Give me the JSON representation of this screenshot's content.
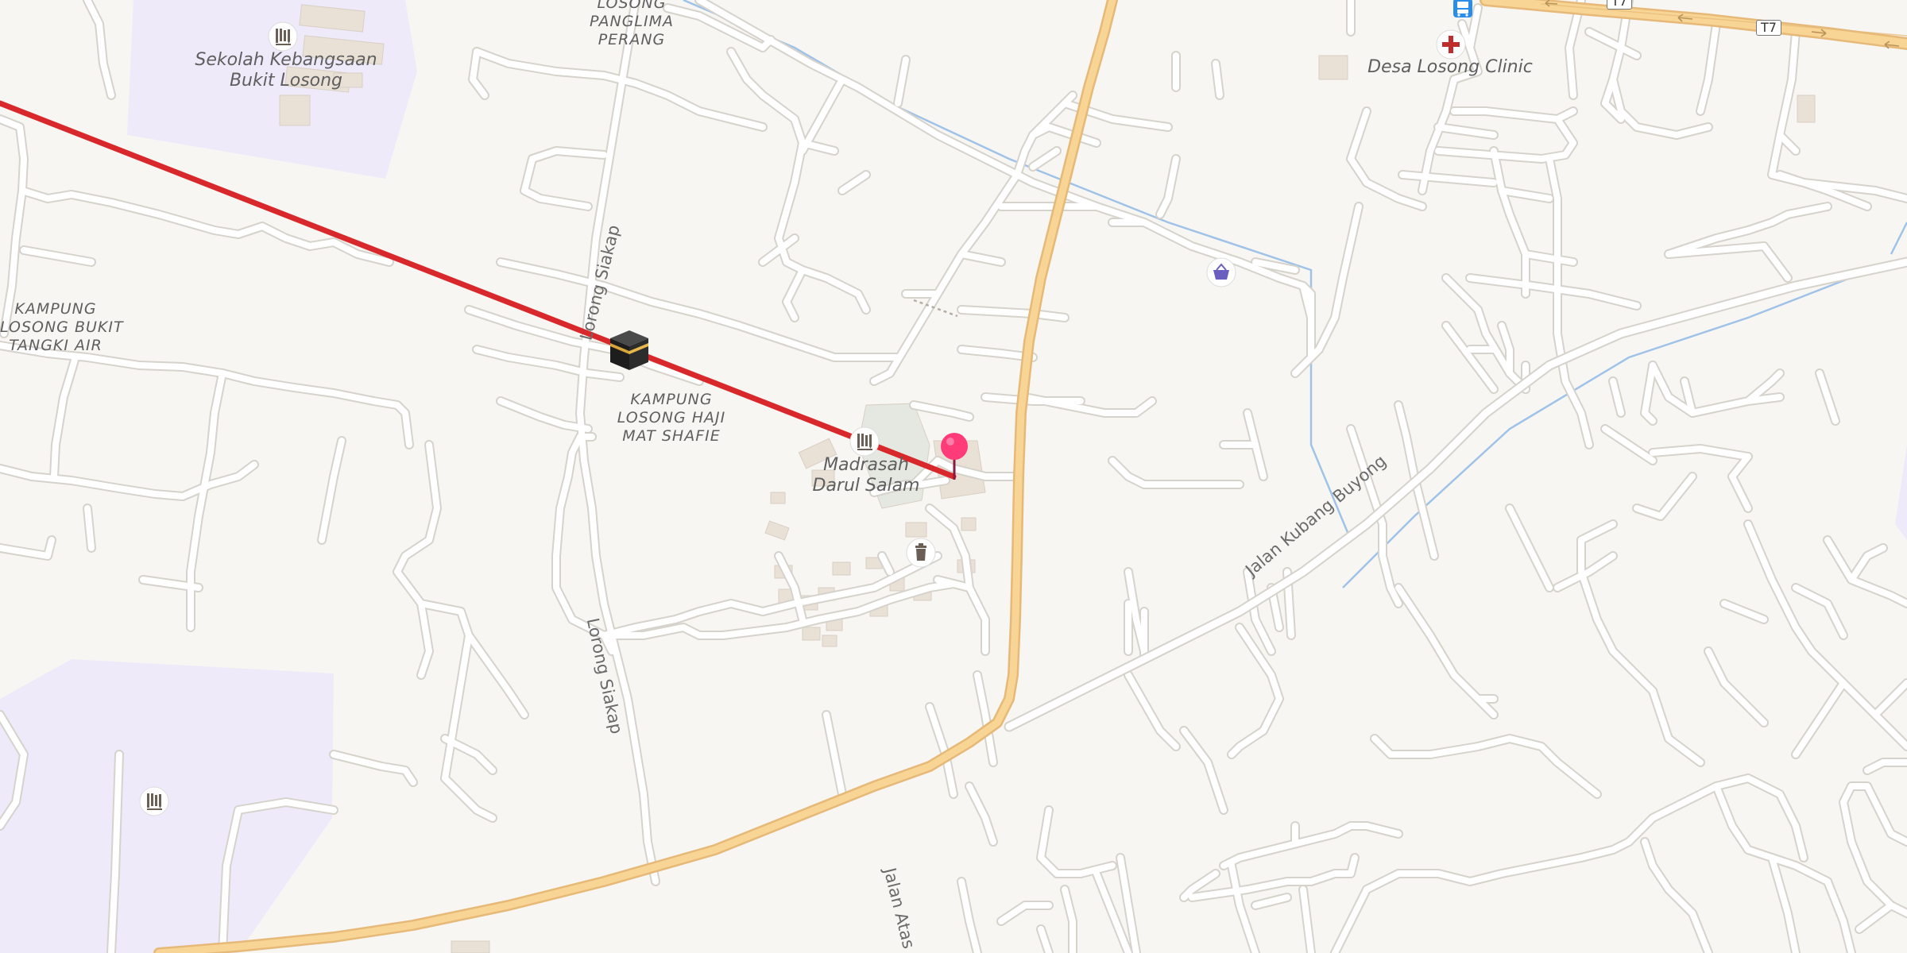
{
  "map": {
    "places": {
      "bukit_tangki_air": [
        "KAMPUNG",
        "LOSONG BUKIT",
        "TANGKI AIR"
      ],
      "panglima_perang": [
        "LOSONG",
        "PANGLIMA",
        "PERANG"
      ],
      "haji_mat_shafie": [
        "KAMPUNG",
        "LOSONG HAJI",
        "MAT SHAFIE"
      ]
    },
    "pois": {
      "school": [
        "Sekolah Kebangsaan",
        "Bukit Losong"
      ],
      "madrasah": [
        "Madrasah",
        "Darul Salam"
      ],
      "clinic": "Desa Losong Clinic"
    },
    "roads": {
      "lorong_siakap_north": "Lorong Siakap",
      "lorong_siakap_south": "Lorong Siakap",
      "jalan_kubang_buyong": "Jalan Kubang Buyong",
      "jalan_atas": "Jalan Atas"
    },
    "route_refs": [
      "T7",
      "T7"
    ],
    "icons": [
      "school-icon",
      "school-icon",
      "madrasah-icon",
      "mosque-kaaba-icon",
      "waste-basket-icon",
      "shop-basket-icon",
      "clinic-cross-icon",
      "bus-stop-icon",
      "location-pin-icon"
    ],
    "colors": {
      "land": "#f8f6f2",
      "school_area": "#efeafa",
      "minor_road": "#ffffff",
      "primary_road": "#f8d594",
      "route_line": "#d8282b",
      "pin": "#ff3b7a",
      "water": "#9fc3e8"
    }
  }
}
